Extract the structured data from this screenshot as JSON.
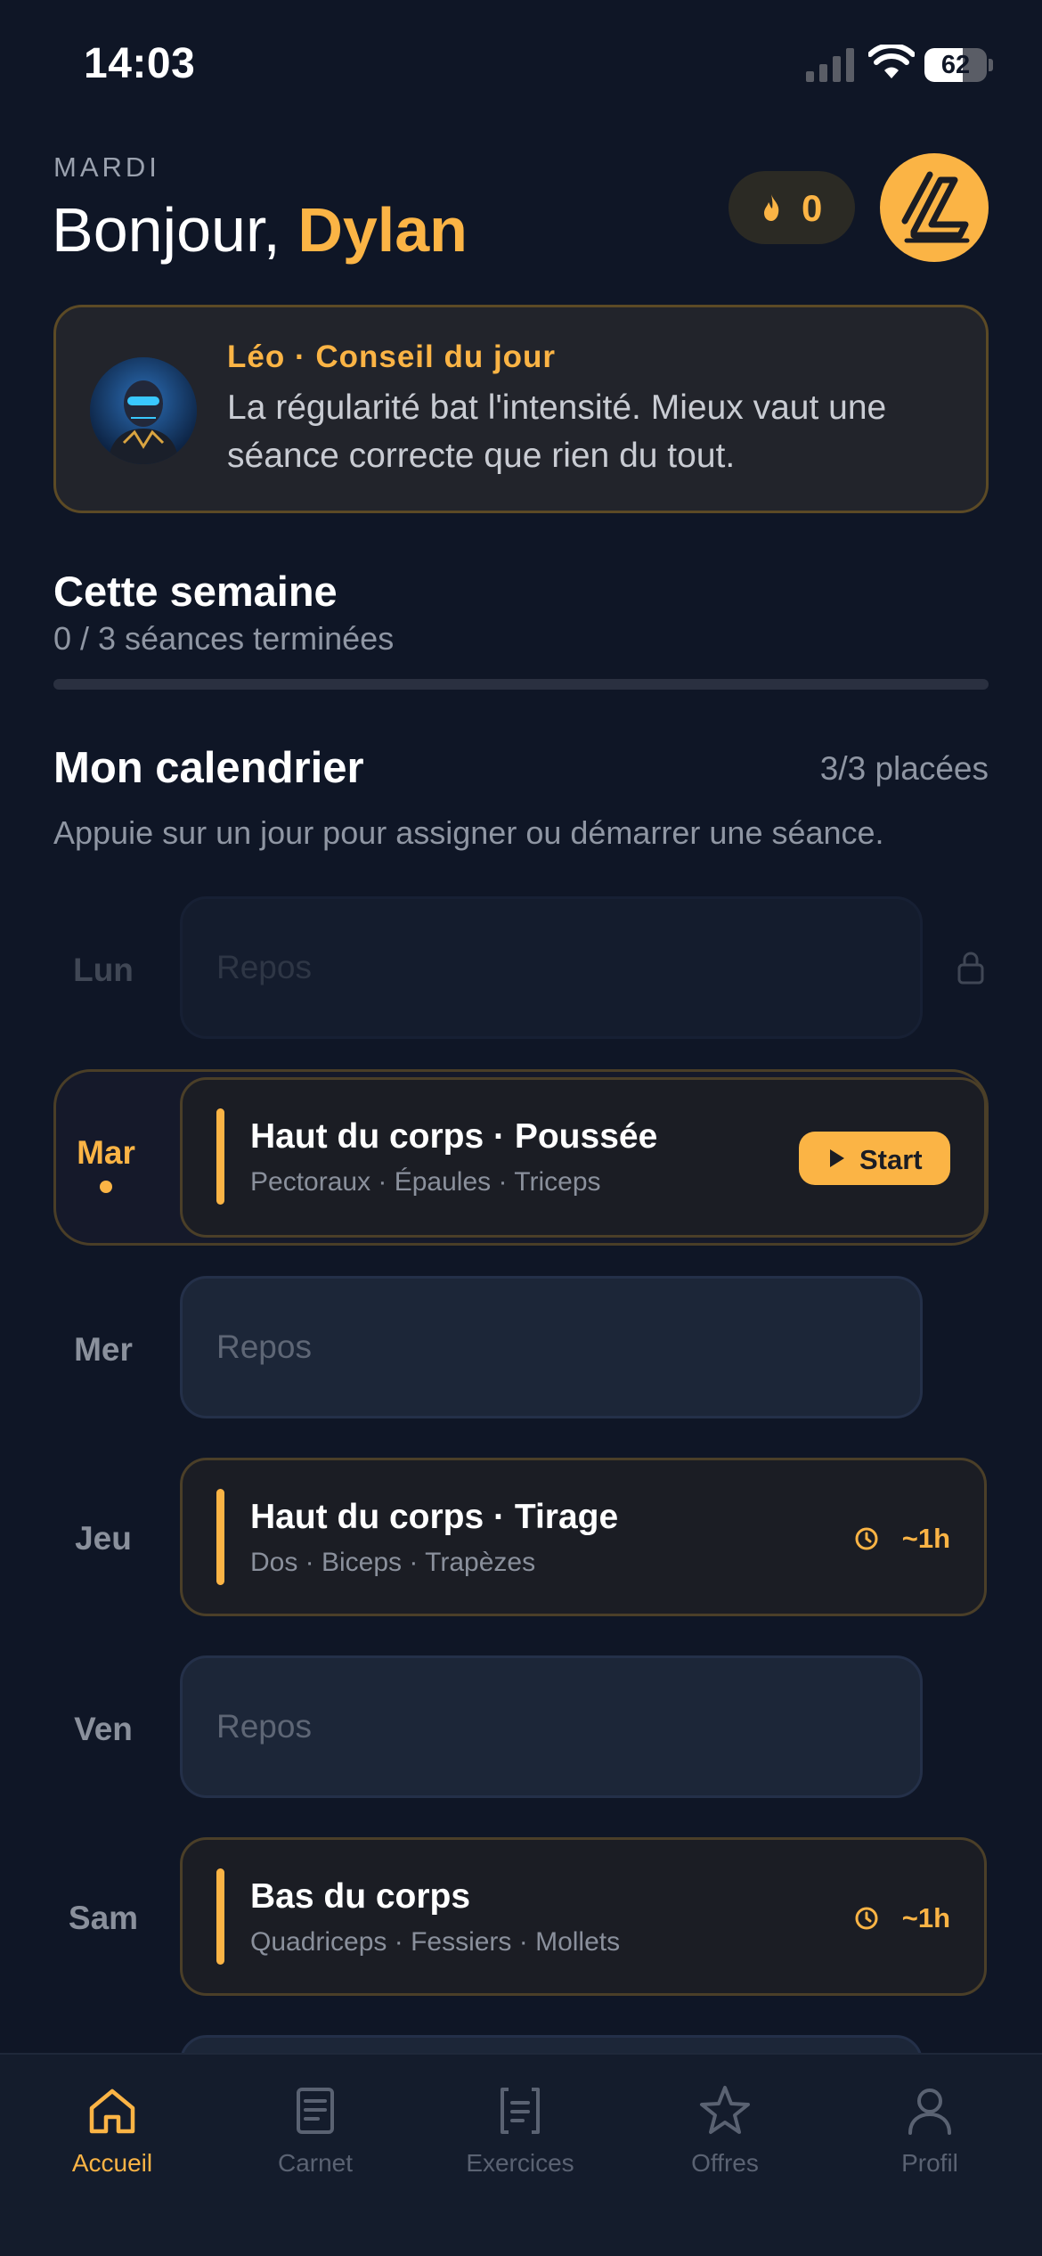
{
  "status_bar": {
    "time": "14:03",
    "battery": "62",
    "battery_level": 0.62
  },
  "header": {
    "day": "MARDI",
    "greeting_prefix": "Bonjour, ",
    "user_name": "Dylan",
    "streak_count": "0"
  },
  "tip": {
    "title": "Léo · Conseil du jour",
    "text": "La régularité bat l'intensité. Mieux vaut une séance correcte que rien du tout."
  },
  "week": {
    "title": "Cette semaine",
    "subtitle": "0 / 3 séances terminées",
    "progress": 0
  },
  "calendar": {
    "title": "Mon calendrier",
    "count": "3/3 placées",
    "hint": "Appuie sur un jour pour assigner ou démarrer une séance.",
    "days": {
      "lun": {
        "day": "Lun",
        "rest": "Repos"
      },
      "mar": {
        "day": "Mar",
        "title": "Haut du corps · Poussée",
        "muscles": "Pectoraux · Épaules · Triceps",
        "action": "Start"
      },
      "mer": {
        "day": "Mer",
        "rest": "Repos"
      },
      "jeu": {
        "day": "Jeu",
        "title": "Haut du corps · Tirage",
        "muscles": "Dos · Biceps · Trapèzes",
        "duration": "~1h"
      },
      "ven": {
        "day": "Ven",
        "rest": "Repos"
      },
      "sam": {
        "day": "Sam",
        "title": "Bas du corps",
        "muscles": "Quadriceps · Fessiers · Mollets",
        "duration": "~1h"
      }
    }
  },
  "nav": {
    "items": [
      {
        "label": "Accueil",
        "icon": "home-icon",
        "active": true
      },
      {
        "label": "Carnet",
        "icon": "notebook-icon",
        "active": false
      },
      {
        "label": "Exercices",
        "icon": "exercises-icon",
        "active": false
      },
      {
        "label": "Offres",
        "icon": "star-icon",
        "active": false
      },
      {
        "label": "Profil",
        "icon": "profile-icon",
        "active": false
      }
    ]
  },
  "colors": {
    "accent": "#fbb445",
    "background": "#0f1626",
    "card": "#1b1d24",
    "muted": "#8f96a3"
  }
}
